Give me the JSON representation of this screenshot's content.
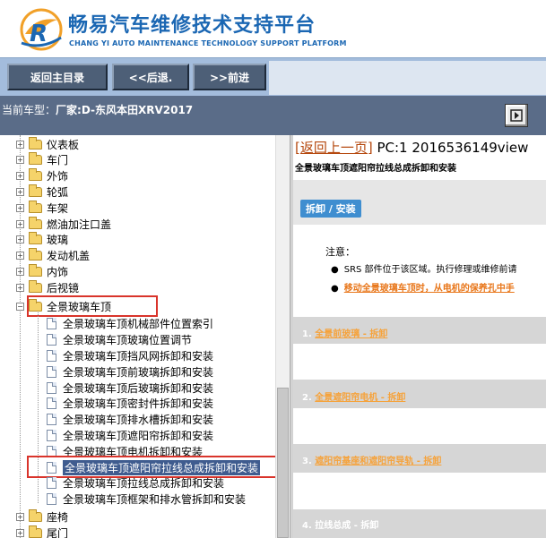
{
  "brand": {
    "title": "畅易汽车维修技术支持平台",
    "subtitle": "CHANG YI AUTO MAINTENANCE TECHNOLOGY SUPPORT PLATFORM",
    "logo_icon": "cy-logo-icon",
    "color": "#1b67b3"
  },
  "toolbar": {
    "home_label": "返回主目录",
    "back_label": "<<后退.",
    "forward_label": ">>前进"
  },
  "car": {
    "prefix": "当前车型：",
    "value": "厂家:D-东风本田XRV2017"
  },
  "tree": {
    "top_folders": [
      {
        "label": "仪表板"
      },
      {
        "label": "车门"
      },
      {
        "label": "外饰"
      },
      {
        "label": "轮弧"
      },
      {
        "label": "车架"
      },
      {
        "label": "燃油加注口盖"
      },
      {
        "label": "玻璃"
      },
      {
        "label": "发动机盖"
      },
      {
        "label": "内饰"
      },
      {
        "label": "后视镜"
      }
    ],
    "open_folder": "全景玻璃车顶",
    "children": [
      "全景玻璃车顶机械部件位置索引",
      "全景玻璃车顶玻璃位置调节",
      "全景玻璃车顶挡风网拆卸和安装",
      "全景玻璃车顶前玻璃拆卸和安装",
      "全景玻璃车顶后玻璃拆卸和安装",
      "全景玻璃车顶密封件拆卸和安装",
      "全景玻璃车顶排水槽拆卸和安装",
      "全景玻璃车顶遮阳帘拆卸和安装",
      "全景玻璃车顶电机拆卸和安装",
      "全景玻璃车顶遮阳帘拉线总成拆卸和安装",
      "全景玻璃车顶拉线总成拆卸和安装",
      "全景玻璃车顶框架和排水管拆卸和安装"
    ],
    "selected_index": 9,
    "bottom_folders": [
      {
        "label": "座椅"
      },
      {
        "label": "尾门"
      }
    ]
  },
  "content": {
    "back_link": "[返回上一页]",
    "doc_id": " PC:1 2016536149view",
    "subtitle": "全景玻璃车顶遮阳帘拉线总成拆卸和安装",
    "tab_label": "拆卸 / 安装",
    "note_label": "注意：",
    "notes": [
      {
        "text": "SRS 部件位于该区域。执行修理或维修前请",
        "warn": false
      },
      {
        "text": "移动全景玻璃车顶时，从电机的保养孔中手",
        "warn": true
      }
    ],
    "steps": [
      {
        "num": "1.",
        "text": "全景前玻璃 - 拆卸",
        "link": true
      },
      {
        "num": "2.",
        "text": "全景遮阳帘电机 - 拆卸",
        "link": true
      },
      {
        "num": "3.",
        "text": "遮阳帘基座和遮阳帘导轨 - 拆卸",
        "link": true
      },
      {
        "num": "4.",
        "text": "拉线总成 - 拆卸",
        "link": false
      }
    ]
  },
  "colors": {
    "toolbar_bg": "#a3bcdc",
    "button_bg": "#4d5f77",
    "carbar_bg": "#5a6c88",
    "highlight_border": "#d9342b",
    "link": "#b5480e",
    "warn": "#e8761a"
  }
}
